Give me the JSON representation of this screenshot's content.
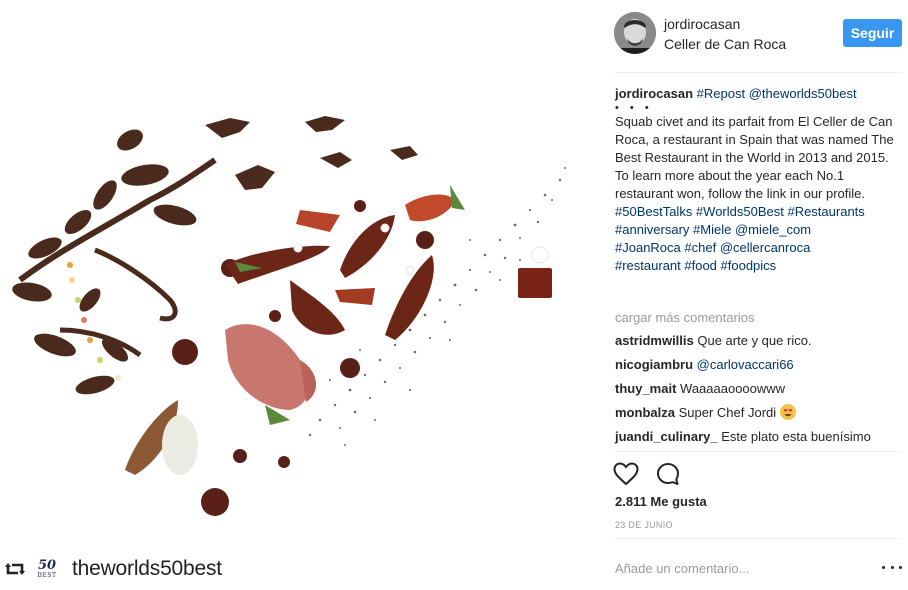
{
  "post": {
    "username": "jordirocasan",
    "location": "Celler de Can Roca",
    "follow_label": "Seguir",
    "caption": {
      "user": "jordirocasan",
      "tag_repost": "#Repost",
      "mention_source": "@theworlds50best",
      "dots": "• • •",
      "text": "Squab civet and its parfait from El Celler de Can Roca, a restaurant in Spain that was named The Best Restaurant in the World in 2013 and 2015. To learn more about the year each No.1 restaurant won, follow the link in our profile.",
      "hashtags_line1": "#50BestTalks #Worlds50Best #Restaurants",
      "hashtags_line2_a": "#anniversary #Miele",
      "hashtags_line2_b": "@miele_com",
      "hashtags_line3_a": "#JoanRoca #chef",
      "hashtags_line3_b": "@cellercanroca",
      "hashtags_line4": "#restaurant #food #foodpics"
    },
    "load_more": "cargar más comentarios",
    "comments": [
      {
        "user": "astridmwillis",
        "text": "Que arte y que rico."
      },
      {
        "user": "nicogiambru",
        "text": "@carlovaccari66"
      },
      {
        "user": "thuy_mait",
        "text": "Waaaaaoooowww"
      },
      {
        "user": "monbalza",
        "text": "Super Chef Jordi"
      },
      {
        "user": "juandi_culinary_",
        "text": "Este plato esta buenísimo"
      }
    ],
    "likes": "2.811 Me gusta",
    "date": "23 DE JUNIO",
    "comment_placeholder": "Añade un comentario..."
  },
  "repost": {
    "logo_number": "50",
    "logo_word": "BEST",
    "account": "theworlds50best"
  },
  "icons": {
    "repost": "repost-icon",
    "heart": "heart-icon",
    "comment": "comment-icon",
    "more": "more-options-icon",
    "emoji": "heart-eyes-emoji-icon"
  },
  "colors": {
    "follow_button": "#3897f0",
    "link": "#003569",
    "muted": "#999999",
    "text": "#262626"
  }
}
